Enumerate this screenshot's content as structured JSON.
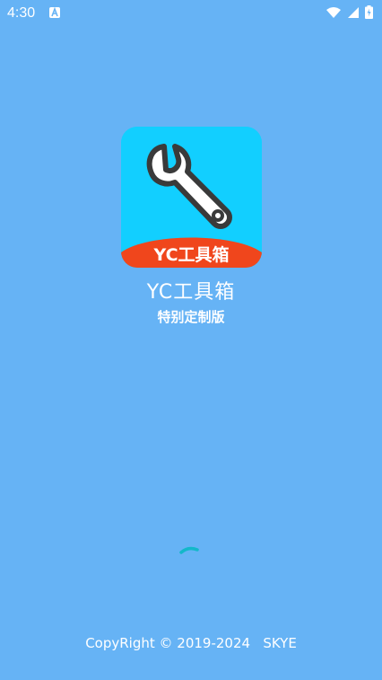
{
  "status_bar": {
    "time": "4:30",
    "notification_icon": "a-letter-notification-icon",
    "wifi_icon": "wifi-icon",
    "signal_icon": "cell-signal-icon",
    "battery_icon": "battery-charging-icon"
  },
  "splash": {
    "icon_banner_text": "YC工具箱",
    "title": "YC工具箱",
    "subtitle": "特别定制版",
    "spinner_icon": "loading-spinner-icon",
    "copyright": "CopyRight © 2019-2024   SKYE"
  },
  "colors": {
    "background": "#66b3f5",
    "icon_background": "#12cfff",
    "icon_banner": "#f0461c",
    "spinner": "#13b8c9"
  }
}
